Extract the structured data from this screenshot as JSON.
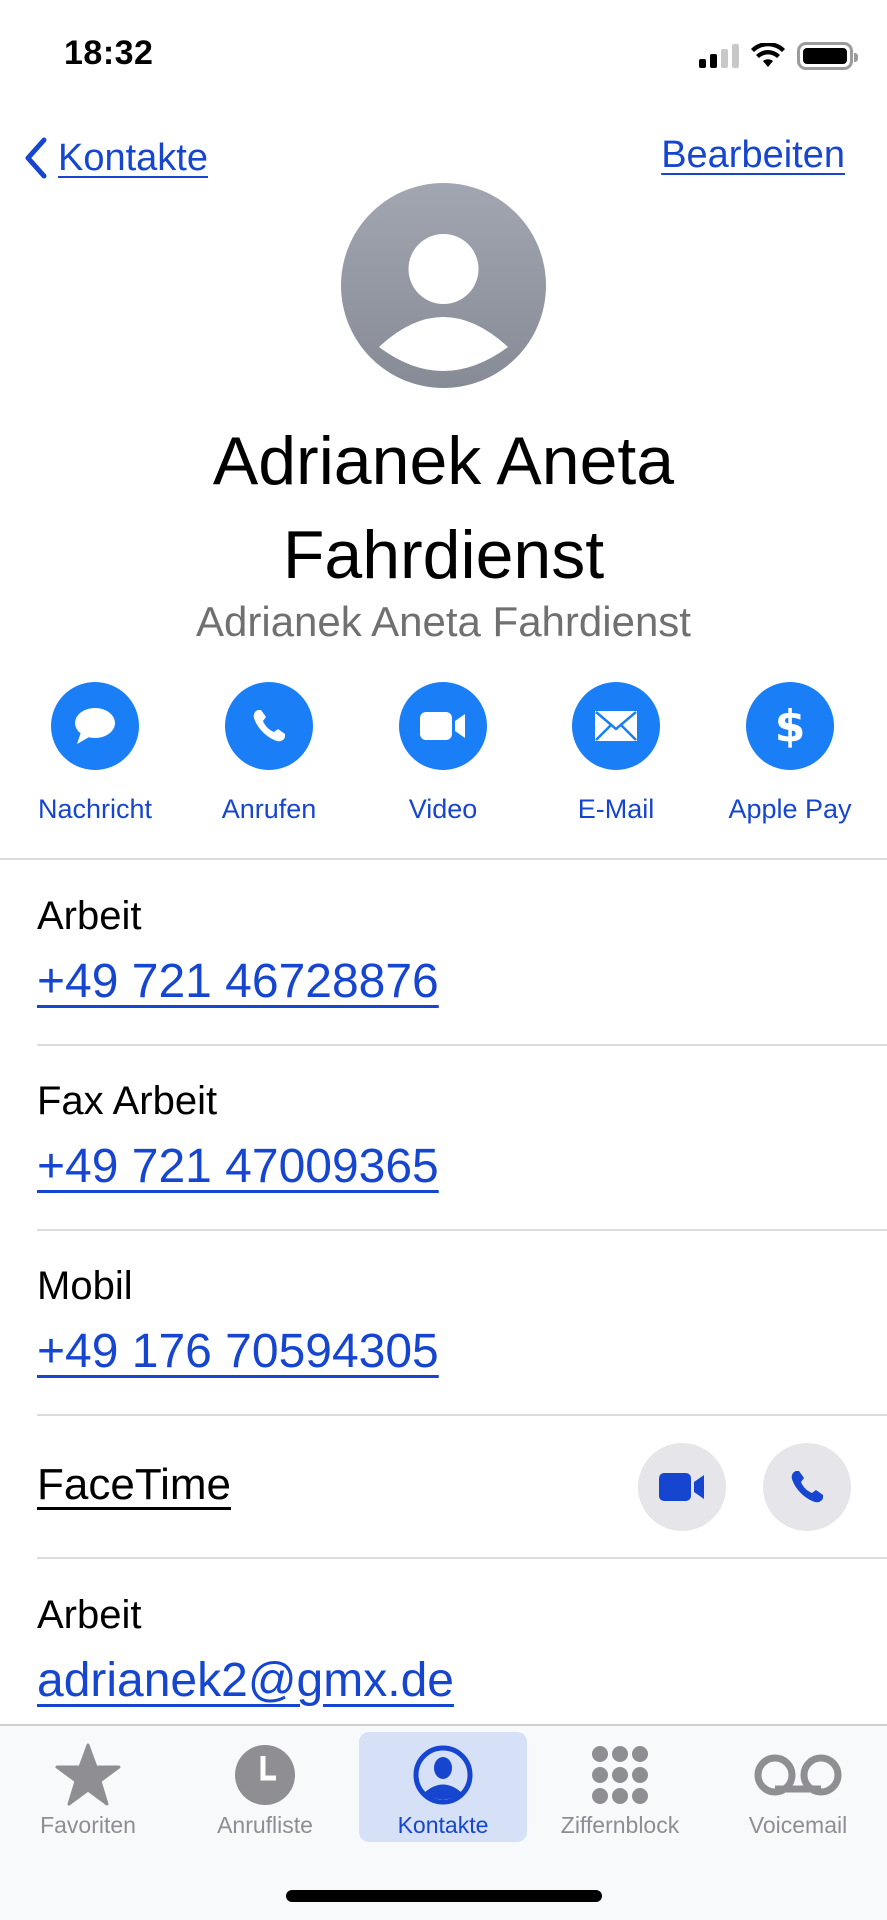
{
  "status_bar": {
    "time": "18:32",
    "icons": [
      "cellular-signal-icon",
      "wifi-icon",
      "battery-icon"
    ]
  },
  "nav": {
    "back_label": "Kontakte",
    "edit_label": "Bearbeiten"
  },
  "contact": {
    "name_line1": "Adrianek Aneta",
    "name_line2": "Fahrdienst",
    "subtitle": "Adrianek Aneta Fahrdienst"
  },
  "actions": [
    {
      "label": "Nachricht",
      "icon": "message-icon"
    },
    {
      "label": "Anrufen",
      "icon": "phone-icon"
    },
    {
      "label": "Video",
      "icon": "video-icon"
    },
    {
      "label": "E-Mail",
      "icon": "mail-icon"
    },
    {
      "label": "Apple Pay",
      "icon": "dollar-icon"
    }
  ],
  "fields": [
    {
      "label": "Arbeit",
      "value": "+49 721 46728876"
    },
    {
      "label": "Fax Arbeit",
      "value": "+49 721 47009365"
    },
    {
      "label": "Mobil",
      "value": "+49 176 70594305"
    }
  ],
  "facetime": {
    "label": "FaceTime",
    "buttons": [
      "video-icon",
      "phone-icon"
    ]
  },
  "email": {
    "label": "Arbeit",
    "value": "adrianek2@gmx.de"
  },
  "tabbar": {
    "active": "Kontakte",
    "items": [
      {
        "label": "Favoriten",
        "icon": "star-icon"
      },
      {
        "label": "Anrufliste",
        "icon": "clock-icon"
      },
      {
        "label": "Kontakte",
        "icon": "person-circle-icon"
      },
      {
        "label": "Ziffernblock",
        "icon": "keypad-icon"
      },
      {
        "label": "Voicemail",
        "icon": "voicemail-icon"
      }
    ]
  },
  "colors": {
    "accent": "#1646d0",
    "action_blue": "#1a7ef7",
    "secondary_text": "#707070",
    "tab_inactive": "#8e8e93",
    "tab_active_bg": "#d6e0f7"
  }
}
